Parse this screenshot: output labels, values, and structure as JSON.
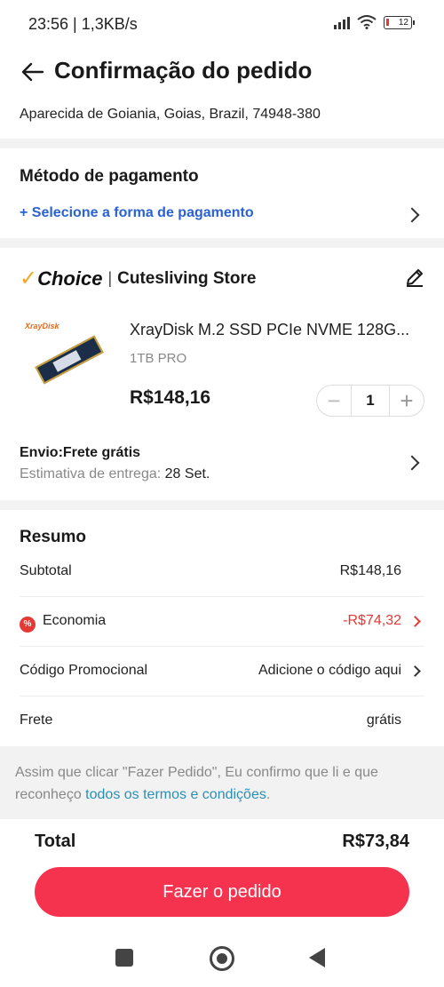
{
  "status_bar": {
    "time_speed": "23:56 | 1,3KB/s",
    "battery": "12"
  },
  "header": {
    "title": "Confirmação do pedido"
  },
  "address": {
    "line": "Aparecida de Goiania, Goias, Brazil, 74948-380"
  },
  "payment": {
    "heading": "Método de pagamento",
    "select_link": "+ Selecione a forma de pagamento"
  },
  "store": {
    "choice_label": "Choice",
    "separator": "|",
    "name": "Cutesliving Store",
    "product": {
      "brand": "XrayDisk",
      "title": "XrayDisk M.2 SSD PCIe NVME 128G...",
      "variant": "1TB PRO",
      "price": "R$148,16",
      "quantity": "1"
    },
    "shipping": {
      "heading": "Envio:Frete grátis",
      "estimate_label": "Estimativa de entrega:",
      "estimate_value": "28 Set."
    }
  },
  "summary": {
    "heading": "Resumo",
    "rows": [
      {
        "label": "Subtotal",
        "value": "R$148,16"
      },
      {
        "label": "Economia",
        "value": "-R$74,32"
      },
      {
        "label": "Código Promocional",
        "value": "Adicione o código aqui"
      },
      {
        "label": "Frete",
        "value": "grátis"
      }
    ]
  },
  "terms": {
    "text": "Assim que clicar \"Fazer Pedido\", Eu confirmo que li e que reconheço ",
    "link": "todos os termos e condições",
    "suffix": "."
  },
  "footer": {
    "total_label": "Total",
    "total_value": "R$73,84",
    "cta": "Fazer o pedido"
  },
  "colors": {
    "accent": "#f5334e",
    "link_blue": "#2a62d3",
    "discount_red": "#e53935",
    "choice_yellow": "#f5a623"
  },
  "icons": [
    "back-arrow-icon",
    "chevron-right-icon",
    "pencil-icon",
    "minus-icon",
    "plus-icon",
    "discount-icon",
    "nav-recents-icon",
    "nav-home-icon",
    "nav-back-icon"
  ]
}
